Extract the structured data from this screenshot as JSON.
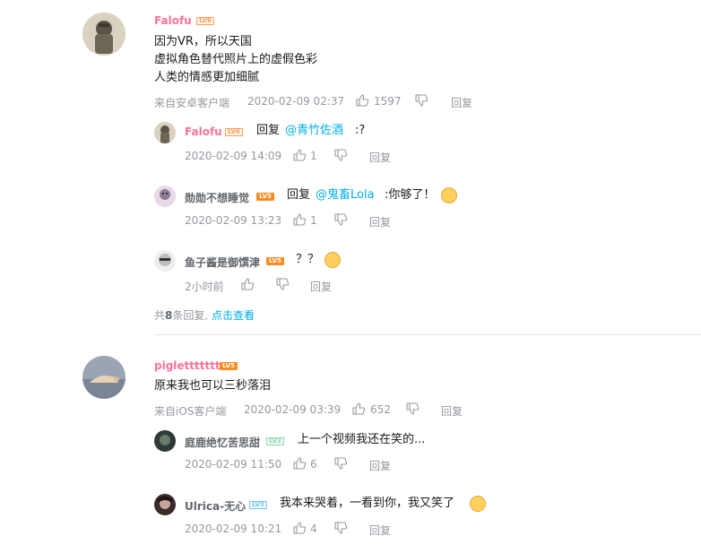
{
  "comments": [
    {
      "user": "Falofu",
      "level": "LV6",
      "lines": [
        "因为VR，所以天国",
        "虚拟角色替代照片上的虚假色彩",
        "人类的情感更加细腻"
      ],
      "source": "来自安卓客户端",
      "time": "2020-02-09 02:37",
      "likes": "1597",
      "reply_label": "回复",
      "replies": [
        {
          "user": "Falofu",
          "level": "LV6",
          "prefix": "回复",
          "mention": "@青竹佐酒",
          "text": ":?",
          "time": "2020-02-09 14:09",
          "likes": "1",
          "reply_label": "回复"
        },
        {
          "user": "勋勋不想睡觉",
          "level": "LV5",
          "prefix": "回复",
          "mention": "@鬼畜Lola",
          "text": ":你够了！",
          "time": "2020-02-09 13:23",
          "likes": "1",
          "reply_label": "回复",
          "emoji": "thinking-emoji"
        },
        {
          "user": "鱼子酱是御馔津",
          "level": "LV5",
          "text": "？？",
          "time": "2小时前",
          "likes": "",
          "reply_label": "回复",
          "emoji": "dizzy-emoji"
        }
      ],
      "summary": {
        "prefix": "共",
        "count": "8",
        "suffix": "条回复,",
        "link": "点击查看"
      }
    },
    {
      "user": "piglettttttt",
      "level": "LV5",
      "lines": [
        "原来我也可以三秒落泪"
      ],
      "source": "来自iOS客户端",
      "time": "2020-02-09 03:39",
      "likes": "652",
      "reply_label": "回复",
      "replies": [
        {
          "user": "庭鹿绝忆苦思甜",
          "level": "LV2",
          "text": "上一个视频我还在笑的...",
          "time": "2020-02-09 11:50",
          "likes": "6",
          "reply_label": "回复"
        },
        {
          "user": "Ulrica-无心",
          "level": "LV3",
          "text": "我本来哭着，一看到你，我又笑了",
          "time": "2020-02-09 10:21",
          "likes": "4",
          "reply_label": "回复",
          "emoji": "sweat-laugh-emoji"
        }
      ]
    }
  ],
  "colors": {
    "pink_name": "#fb7299",
    "link": "#00aeec",
    "meta": "#9499a0"
  }
}
